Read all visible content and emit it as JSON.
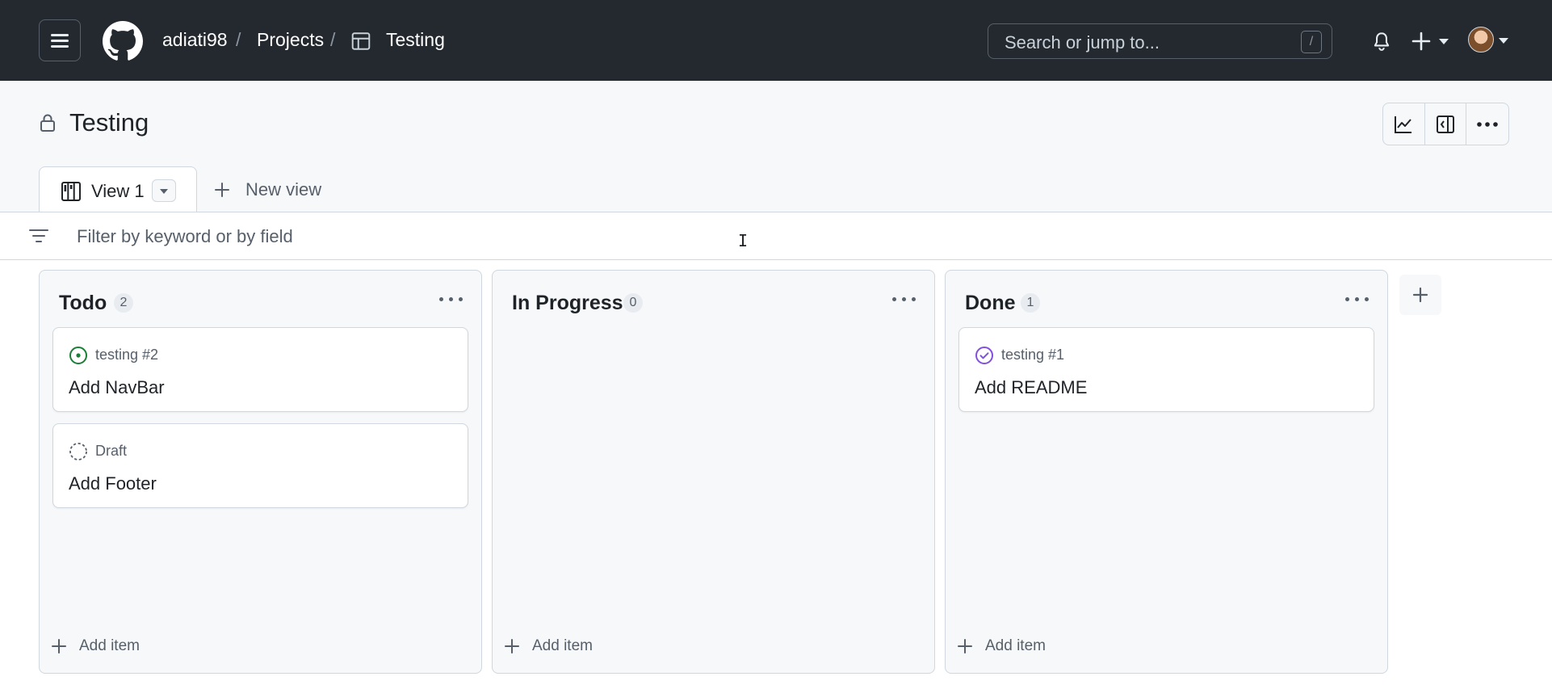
{
  "header": {
    "breadcrumb": {
      "owner": "adiati98",
      "projects": "Projects",
      "project": "Testing",
      "separator": "/"
    },
    "search": {
      "placeholder": "Search or jump to...",
      "shortcut": "/"
    },
    "icons": [
      "hamburger-icon",
      "github-logo-icon",
      "table-icon",
      "bell-icon",
      "plus-icon",
      "avatar"
    ]
  },
  "project": {
    "title": "Testing",
    "visibility_icon": "lock-icon",
    "toolbar_icons": [
      "insights-graph-icon",
      "sidebar-panel-icon",
      "kebab-menu-icon"
    ]
  },
  "views": {
    "active_tab": "View 1",
    "new_view_label": "New view"
  },
  "filter": {
    "placeholder": "Filter by keyword or by field"
  },
  "board": {
    "add_item_label": "Add item",
    "columns": [
      {
        "title": "Todo",
        "count": "2",
        "cards": [
          {
            "status": "open-issue",
            "ref": "testing #2",
            "title": "Add NavBar"
          },
          {
            "status": "draft",
            "ref": "Draft",
            "title": "Add Footer"
          }
        ]
      },
      {
        "title": "In Progress",
        "count": "0",
        "cards": []
      },
      {
        "title": "Done",
        "count": "1",
        "cards": [
          {
            "status": "closed-issue",
            "ref": "testing #1",
            "title": "Add README"
          }
        ]
      }
    ]
  },
  "colors": {
    "header_bg": "#24292f",
    "open_issue": "#1a7f37",
    "closed_issue": "#8250df",
    "muted_text": "#57606a"
  }
}
